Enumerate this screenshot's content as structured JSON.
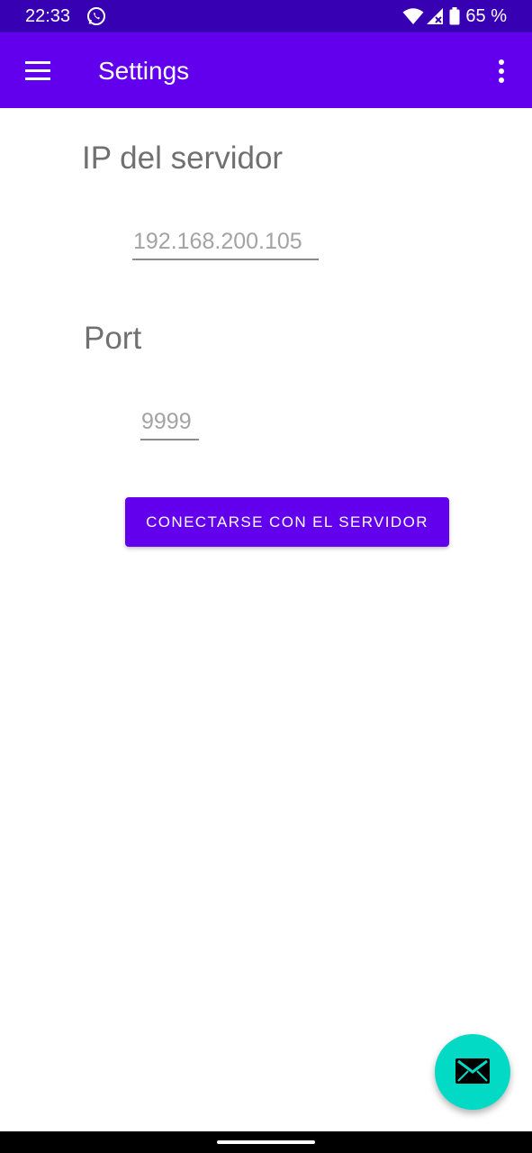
{
  "status_bar": {
    "time": "22:33",
    "battery_text": "65 %",
    "app_icon": "whatsapp-icon",
    "icons": [
      "wifi-icon",
      "signal-icon",
      "battery-icon"
    ]
  },
  "app_bar": {
    "title": "Settings",
    "menu_icon": "hamburger-menu-icon",
    "overflow_icon": "more-vert-icon",
    "color": "#6200ee"
  },
  "form": {
    "ip_label": "IP del servidor",
    "ip_value": "192.168.200.105",
    "port_label": "Port",
    "port_value": "9999",
    "connect_label": "CONECTARSE CON EL SERVIDOR"
  },
  "fab": {
    "icon": "email-icon",
    "color": "#03dac5"
  },
  "colors": {
    "status_bar": "#3700b3",
    "primary": "#6200ee",
    "accent": "#03dac5"
  }
}
